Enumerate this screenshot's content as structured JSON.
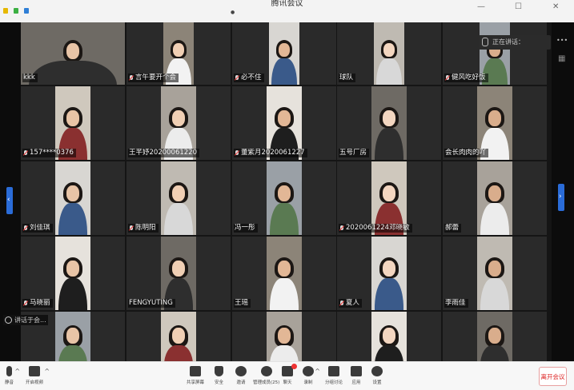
{
  "window": {
    "title": "腾讯会议",
    "status_icon_colors": [
      "#e6b800",
      "#3cb043",
      "#2f7fd6"
    ]
  },
  "stage": {
    "speaker_label": "正在讲话：",
    "sidebar_label": "讲话于会..."
  },
  "participants": [
    {
      "name": "kkk",
      "muted": false,
      "video": true
    },
    {
      "name": "言午要开个会",
      "muted": true,
      "video": true
    },
    {
      "name": "必不住",
      "muted": true,
      "video": true
    },
    {
      "name": "球队",
      "muted": false,
      "video": true
    },
    {
      "name": "健风吃好饭",
      "muted": true,
      "video": true
    },
    {
      "name": "157****0376",
      "muted": true,
      "video": true
    },
    {
      "name": "王芊妤20200061220",
      "muted": false,
      "video": true
    },
    {
      "name": "董紫月2020061227",
      "muted": true,
      "video": true
    },
    {
      "name": "五号厂房",
      "muted": false,
      "video": true
    },
    {
      "name": "会长肉肉的吖",
      "muted": false,
      "video": true
    },
    {
      "name": "刘佳琪",
      "muted": true,
      "video": true
    },
    {
      "name": "陈明阳",
      "muted": true,
      "video": true
    },
    {
      "name": "冯一彤",
      "muted": false,
      "video": true
    },
    {
      "name": "2020061224邓晓敏",
      "muted": true,
      "video": true
    },
    {
      "name": "郝蕾",
      "muted": false,
      "video": true
    },
    {
      "name": "马晓丽",
      "muted": true,
      "video": true
    },
    {
      "name": "FENGYUTING",
      "muted": false,
      "video": true
    },
    {
      "name": "王瑶",
      "muted": false,
      "video": true
    },
    {
      "name": "夏人",
      "muted": true,
      "video": true
    },
    {
      "name": "李雨佳",
      "muted": false,
      "video": true
    }
  ],
  "toolbar": {
    "left": [
      {
        "name": "mic",
        "label": "静音",
        "icon": "microphone-icon"
      },
      {
        "name": "video",
        "label": "开启视频",
        "icon": "video-camera-icon"
      }
    ],
    "center": [
      {
        "name": "share",
        "label": "共享屏幕",
        "icon": "share-screen-icon"
      },
      {
        "name": "security",
        "label": "安全",
        "icon": "shield-icon"
      },
      {
        "name": "invite",
        "label": "邀请",
        "icon": "invite-user-icon"
      },
      {
        "name": "members",
        "label": "管理成员(25)",
        "icon": "members-icon"
      },
      {
        "name": "chat",
        "label": "聊天",
        "icon": "chat-bubble-icon"
      },
      {
        "name": "record",
        "label": "录制",
        "icon": "record-icon"
      },
      {
        "name": "rooms",
        "label": "分组讨论",
        "icon": "breakout-rooms-icon"
      },
      {
        "name": "apps",
        "label": "应用",
        "icon": "apps-grid-icon"
      },
      {
        "name": "settings",
        "label": "设置",
        "icon": "gear-icon"
      }
    ],
    "leave_label": "离开会议"
  }
}
